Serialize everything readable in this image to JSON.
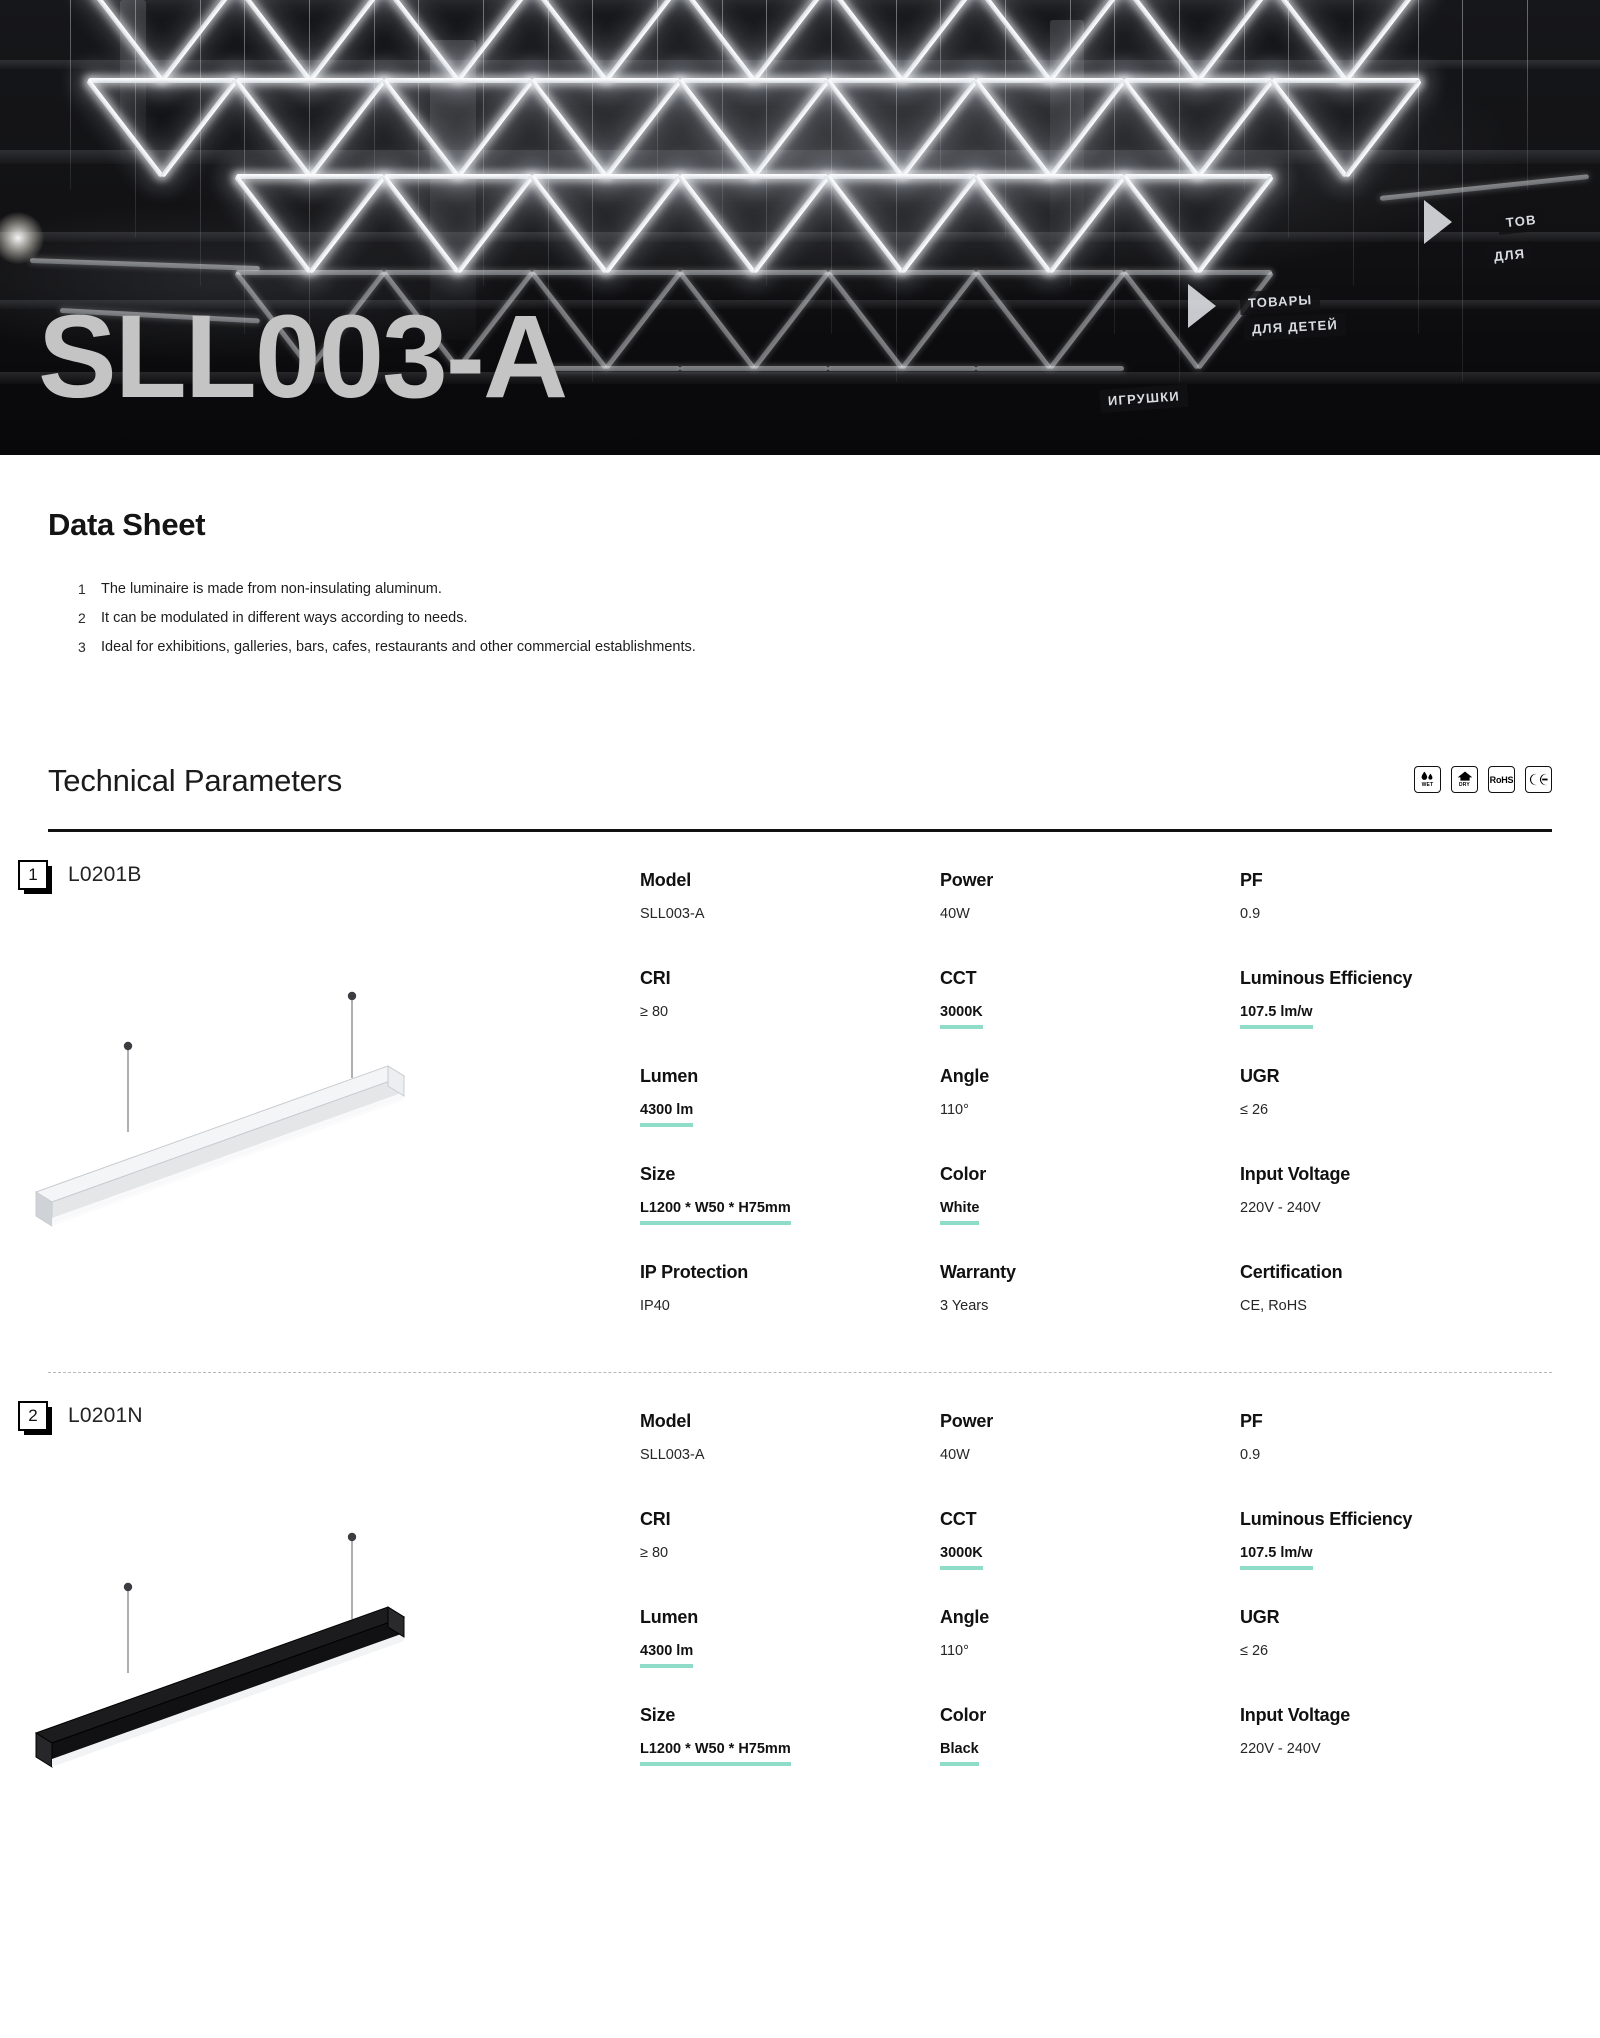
{
  "hero": {
    "title": "SLL003-A",
    "scene_signs": [
      "ТОВАРЫ",
      "ДЛЯ ДЕТЕЙ",
      "ИГРУШКИ",
      "ТОВ",
      "ДЛЯ"
    ]
  },
  "datasheet": {
    "title": "Data Sheet",
    "points": [
      {
        "num": "1",
        "text": "The luminaire is made from non-insulating aluminum."
      },
      {
        "num": "2",
        "text": "It can be modulated in different ways according to needs."
      },
      {
        "num": "3",
        "text": "Ideal for exhibitions, galleries, bars, cafes, restaurants and other commercial establishments."
      }
    ]
  },
  "technical": {
    "title": "Technical Parameters",
    "badges": [
      {
        "name": "wet-rating-badge",
        "caption": "WET"
      },
      {
        "name": "dry-rating-badge",
        "caption": "DRY"
      },
      {
        "name": "rohs-badge",
        "caption": "RoHS"
      },
      {
        "name": "ce-badge",
        "caption": "CE"
      }
    ],
    "accent_color": "#8fdcc8"
  },
  "products": [
    {
      "index": "1",
      "code": "L0201B",
      "body_color": "white",
      "specs": [
        {
          "label": "Model",
          "value": "SLL003-A",
          "highlight": false
        },
        {
          "label": "Power",
          "value": "40W",
          "highlight": false
        },
        {
          "label": "PF",
          "value": "0.9",
          "highlight": false
        },
        {
          "label": "CRI",
          "value": "≥ 80",
          "highlight": false
        },
        {
          "label": "CCT",
          "value": "3000K",
          "highlight": true
        },
        {
          "label": "Luminous Efficiency",
          "value": "107.5 lm/w",
          "highlight": true
        },
        {
          "label": "Lumen",
          "value": "4300 lm",
          "highlight": true
        },
        {
          "label": "Angle",
          "value": "110°",
          "highlight": false
        },
        {
          "label": "UGR",
          "value": "≤ 26",
          "highlight": false
        },
        {
          "label": "Size",
          "value": "L1200 * W50 * H75mm",
          "highlight": true
        },
        {
          "label": "Color",
          "value": "White",
          "highlight": true
        },
        {
          "label": "Input Voltage",
          "value": "220V - 240V",
          "highlight": false
        },
        {
          "label": "IP Protection",
          "value": "IP40",
          "highlight": false
        },
        {
          "label": "Warranty",
          "value": "3 Years",
          "highlight": false
        },
        {
          "label": "Certification",
          "value": "CE, RoHS",
          "highlight": false
        }
      ]
    },
    {
      "index": "2",
      "code": "L0201N",
      "body_color": "black",
      "specs": [
        {
          "label": "Model",
          "value": "SLL003-A",
          "highlight": false
        },
        {
          "label": "Power",
          "value": "40W",
          "highlight": false
        },
        {
          "label": "PF",
          "value": "0.9",
          "highlight": false
        },
        {
          "label": "CRI",
          "value": "≥ 80",
          "highlight": false
        },
        {
          "label": "CCT",
          "value": "3000K",
          "highlight": true
        },
        {
          "label": "Luminous Efficiency",
          "value": "107.5 lm/w",
          "highlight": true
        },
        {
          "label": "Lumen",
          "value": "4300 lm",
          "highlight": true
        },
        {
          "label": "Angle",
          "value": "110°",
          "highlight": false
        },
        {
          "label": "UGR",
          "value": "≤ 26",
          "highlight": false
        },
        {
          "label": "Size",
          "value": "L1200 * W50 * H75mm",
          "highlight": true
        },
        {
          "label": "Color",
          "value": "Black",
          "highlight": true
        },
        {
          "label": "Input Voltage",
          "value": "220V - 240V",
          "highlight": false
        }
      ]
    }
  ]
}
